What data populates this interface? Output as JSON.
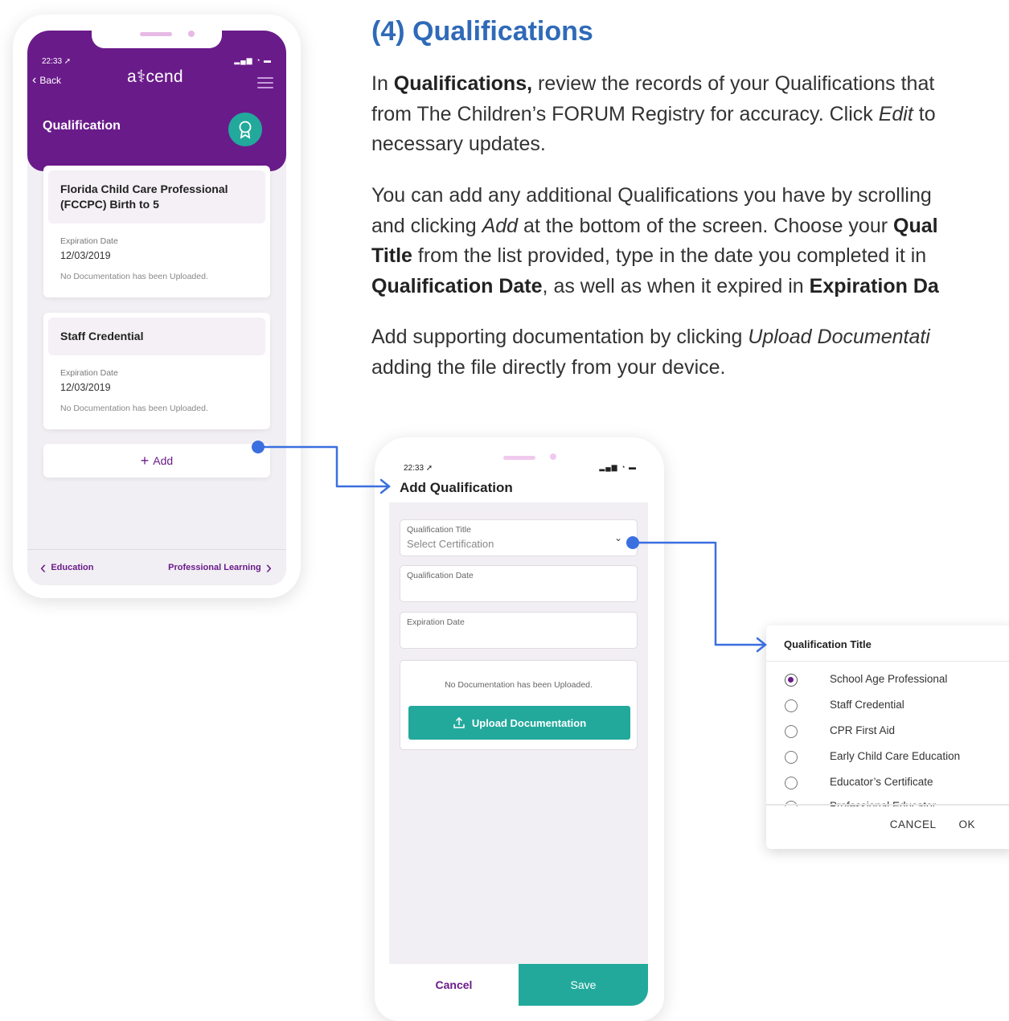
{
  "phone1": {
    "time": "22:33 ➚",
    "status_icons": "▂▄▆ ◔ ▬",
    "back_label": "Back",
    "logo": "a⚕cend",
    "screen_title": "Qualification",
    "cards": [
      {
        "title": "Florida Child Care Professional (FCCPC) Birth to 5",
        "expiration_label": "Expiration Date",
        "expiration_value": "12/03/2019",
        "doc_note": "No Documentation has been Uploaded."
      },
      {
        "title": "Staff Credential",
        "expiration_label": "Expiration Date",
        "expiration_value": "12/03/2019",
        "doc_note": "No Documentation has been Uploaded."
      }
    ],
    "add_label": "Add",
    "footer_prev": "Education",
    "footer_next": "Professional Learning"
  },
  "instructions": {
    "heading": "(4)  Qualifications",
    "p1_a": "In ",
    "p1_b": "Qualifications,",
    "p1_c": " review the records of your Qualifications that",
    "p1_line2_a": "from The Children’s FORUM Registry for accuracy. Click ",
    "p1_line2_b": "Edit",
    "p1_line2_c": " to",
    "p1_line3": "necessary updates.",
    "p2_line1": "You can add any additional Qualifications you have by scrolling",
    "p2_line2_a": "and clicking ",
    "p2_line2_b": "Add",
    "p2_line2_c": " at the bottom of the screen. Choose your ",
    "p2_line2_d": "Qual",
    "p2_line3_a": "Title",
    "p2_line3_b": " from the list provided, type in the date you completed it in",
    "p2_line4_a": "Qualification Date",
    "p2_line4_b": ", as well as when it expired in ",
    "p2_line4_c": "Expiration Da",
    "p3_line1_a": "Add supporting documentation by clicking ",
    "p3_line1_b": "Upload Documentati",
    "p3_line2": "adding the file directly from your device."
  },
  "phone2": {
    "time": "22:33 ➚",
    "status_icons": "▂▄▆ ◔ ▬",
    "title": "Add Qualification",
    "qual_title_label": "Qualification Title",
    "qual_title_placeholder": "Select Certification",
    "qual_date_label": "Qualification Date",
    "exp_date_label": "Expiration Date",
    "doc_note": "No Documentation has been Uploaded.",
    "upload_label": "Upload Documentation",
    "cancel_label": "Cancel",
    "save_label": "Save"
  },
  "dialog": {
    "title": "Qualification Title",
    "options": [
      {
        "label": "School Age Professional",
        "selected": true
      },
      {
        "label": "Staff Credential",
        "selected": false
      },
      {
        "label": "CPR First Aid",
        "selected": false
      },
      {
        "label": "Early Child Care Education",
        "selected": false
      },
      {
        "label": "Educator’s Certificate",
        "selected": false
      },
      {
        "label": "Professional Educator",
        "selected": false
      }
    ],
    "cancel_label": "CANCEL",
    "ok_label": "OK"
  },
  "colors": {
    "brand_purple": "#6a1b8a",
    "teal": "#22a99c",
    "heading_blue": "#2f6ab8",
    "arrow_blue": "#3a6fe0"
  }
}
